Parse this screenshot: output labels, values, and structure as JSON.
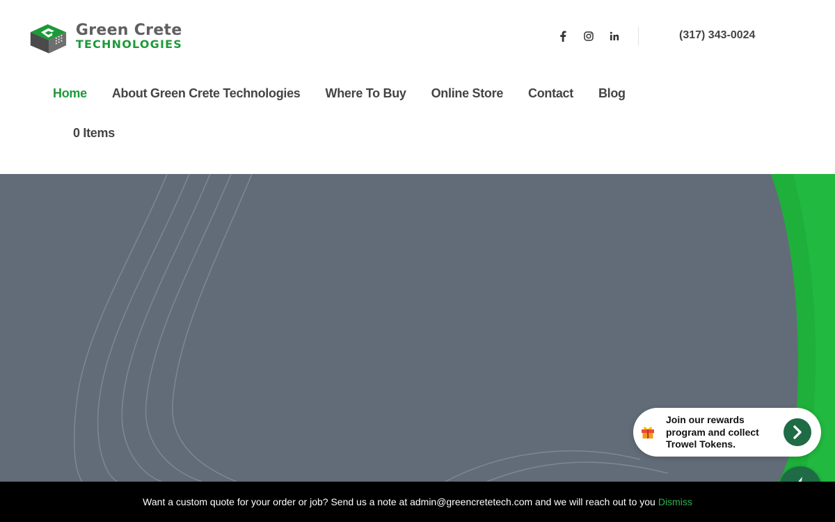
{
  "brand": {
    "name_line1": "Green Crete",
    "name_line2": "TECHNOLOGIES",
    "colors": {
      "green": "#1c9a3a",
      "dark_green": "#1f6b45",
      "gray": "#5f5f5f"
    }
  },
  "header": {
    "social": [
      {
        "name": "facebook",
        "icon": "facebook-icon"
      },
      {
        "name": "instagram",
        "icon": "instagram-icon"
      },
      {
        "name": "linkedin",
        "icon": "linkedin-icon"
      }
    ],
    "phone": "(317) 343-0024"
  },
  "nav": {
    "items": [
      {
        "label": "Home",
        "active": true
      },
      {
        "label": "About Green Crete Technologies",
        "active": false
      },
      {
        "label": "Where To Buy",
        "active": false
      },
      {
        "label": "Online Store",
        "active": false
      },
      {
        "label": "Contact",
        "active": false
      },
      {
        "label": "Blog",
        "active": false
      }
    ],
    "cart_label": "0 Items"
  },
  "hero": {
    "background_color": "#626c78",
    "accent_color": "#1eb03a"
  },
  "rewards": {
    "icon": "gift-icon",
    "text": "Join our rewards program and collect Trowel Tokens.",
    "button_icon": "chevron-right-icon"
  },
  "fab": {
    "icon": "lightning-bolt-icon"
  },
  "notice": {
    "message": "Want a custom quote for your order or job? Send us a note at admin@greencretetech.com and we will reach out to you",
    "dismiss_label": "Dismiss"
  }
}
